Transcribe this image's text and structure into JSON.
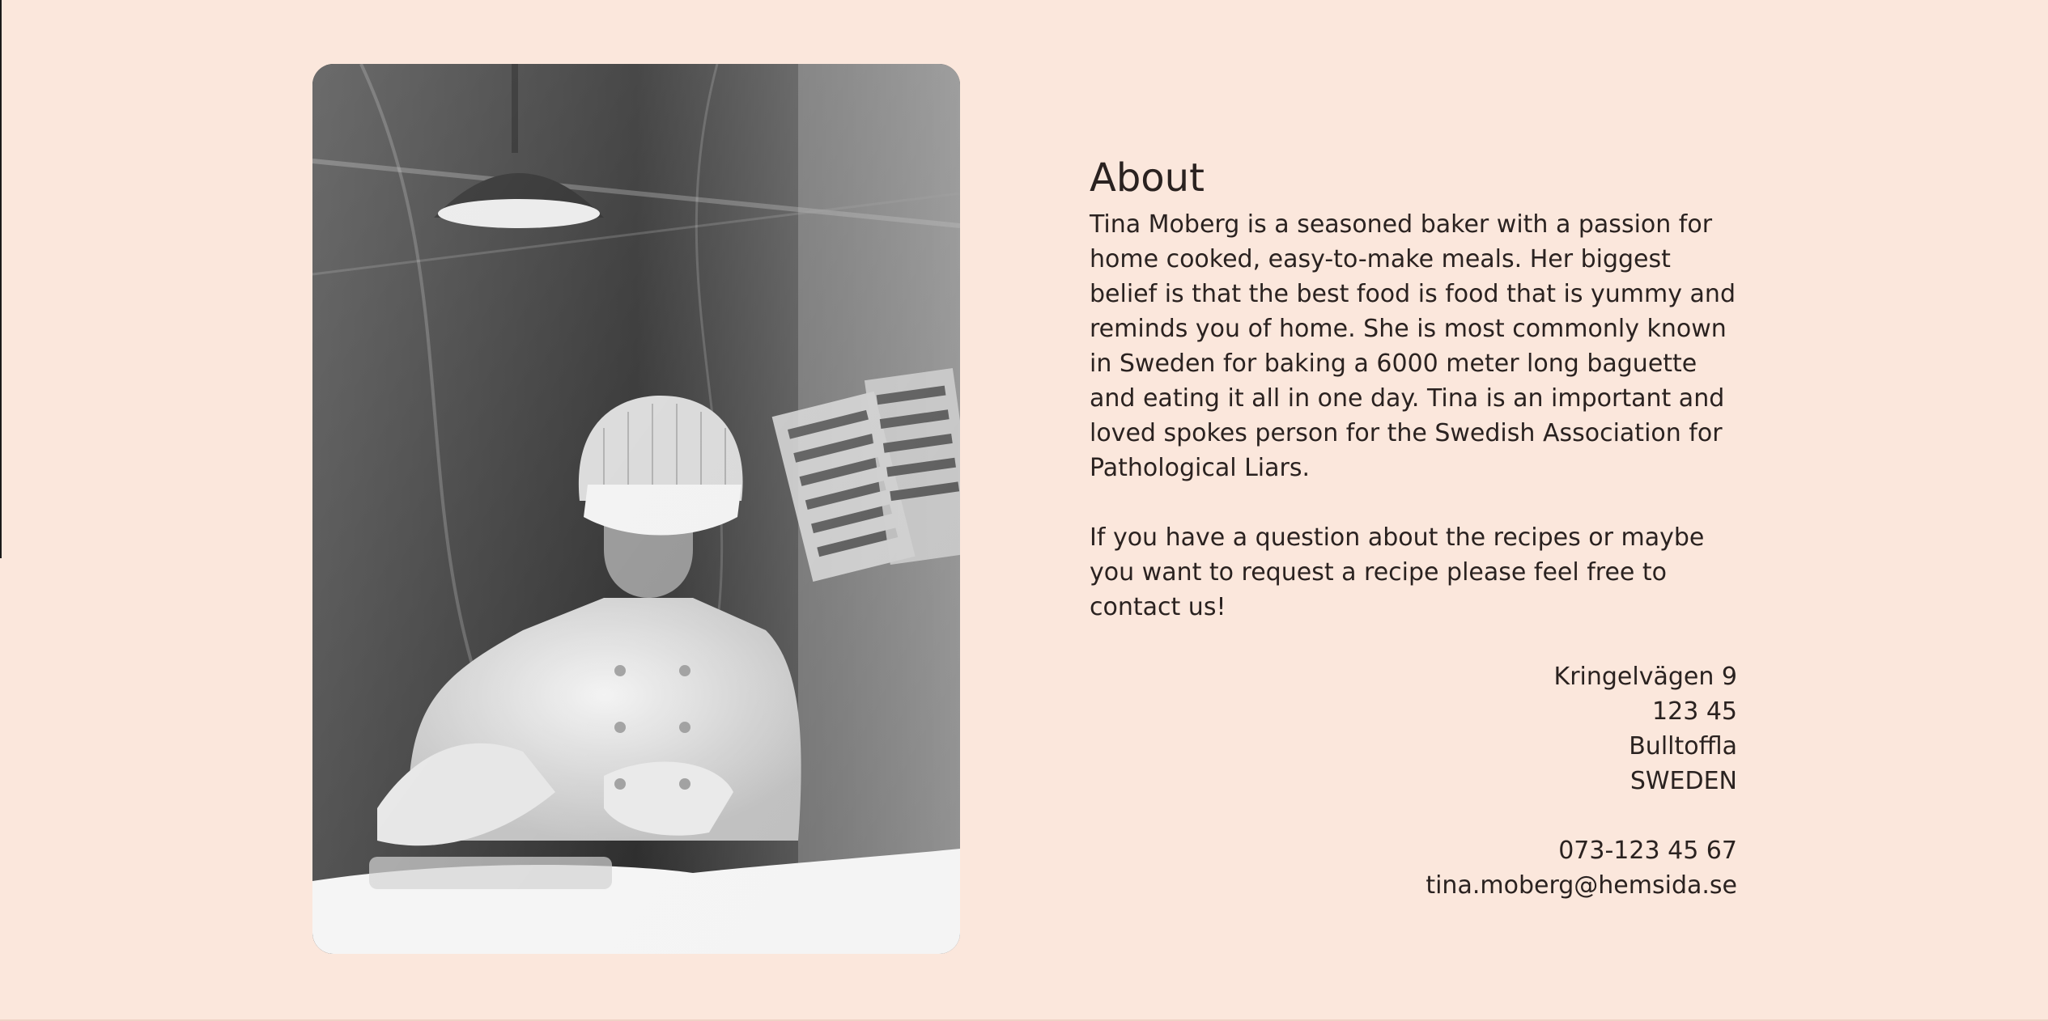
{
  "about": {
    "title": "About",
    "bio": "Tina Moberg is a seasoned baker with a passion for home cooked, easy-to-make meals. Her biggest belief is that the best food is food that is yummy and reminds you of home. She is most commonly known in Sweden for baking a 6000 meter long baguette and eating it all in one day. Tina is an important and loved spokes person for the Swedish Association for Pathological Liars.",
    "contact_invite": "If you have a question about the recipes or maybe you want to request a recipe please feel free to contact us!"
  },
  "address": {
    "street": "Kringelvägen 9",
    "postal_code": "123 45",
    "city": "Bulltoffla",
    "country": "SWEDEN"
  },
  "contact": {
    "phone": "073-123 45 67",
    "email": "tina.moberg@hemsida.se"
  },
  "colors": {
    "background": "#fbe7dc",
    "text": "#2a2220"
  }
}
